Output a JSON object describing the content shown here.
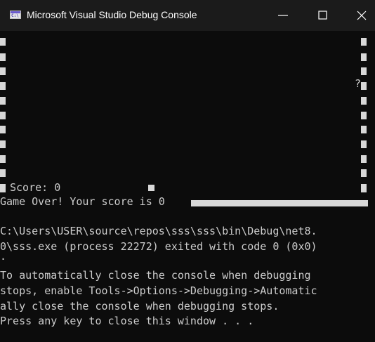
{
  "window": {
    "title": "Microsoft Visual Studio Debug Console",
    "icon_glyph": "C:\\"
  },
  "controls": {
    "minimize": "minimize-icon",
    "maximize": "maximize-icon",
    "close": "close-icon"
  },
  "game": {
    "question_mark": "?",
    "score_line": "Score: 0",
    "game_over_line": "Game Over! Your score is 0"
  },
  "console_lines": [
    "C:\\Users\\USER\\source\\repos\\sss\\sss\\bin\\Debug\\net8.",
    "0\\sss.exe (process 22272) exited with code 0 (0x0)",
    ".",
    "To automatically close the console when debugging",
    "stops, enable Tools->Options->Debugging->Automatic",
    "ally close the console when debugging stops.",
    "Press any key to close this window . . ."
  ],
  "colors": {
    "titlebar_bg": "#1b1b1b",
    "console_bg": "#0c0c0c",
    "text": "#cccccc",
    "wall": "#d8d8d8"
  }
}
